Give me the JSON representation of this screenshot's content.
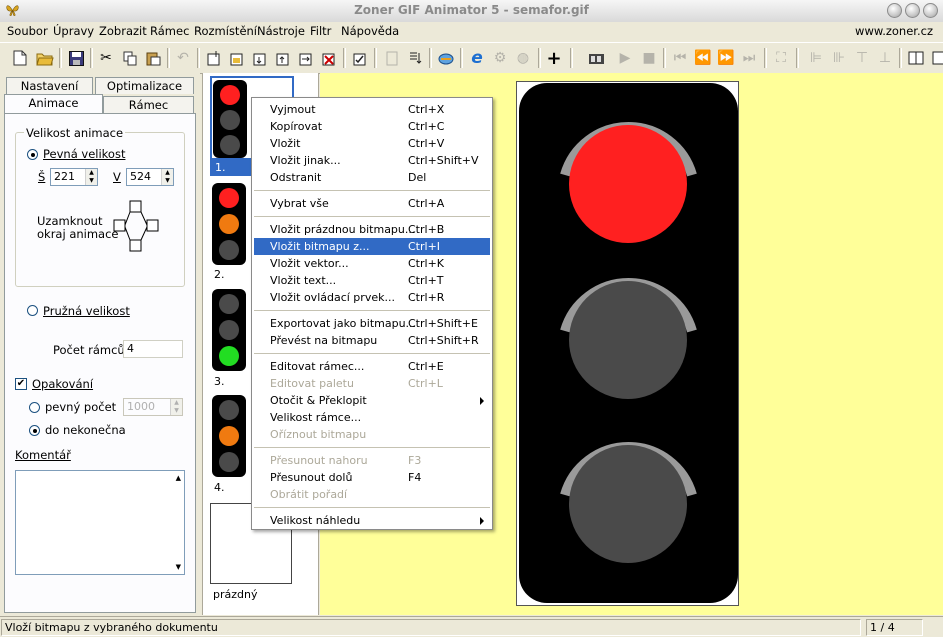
{
  "window": {
    "title": "Zoner GIF Animator 5 - semafor.gif"
  },
  "menubar": {
    "items": [
      "Soubor",
      "Úpravy",
      "Zobrazit",
      "Rámec",
      "Rozmístění",
      "Nástroje",
      "Filtr",
      "Nápověda"
    ],
    "url": "www.zoner.cz"
  },
  "toolbar": {
    "icons": [
      "new-icon",
      "open-icon",
      "save-icon",
      "cut-icon",
      "copy-icon",
      "paste-icon",
      "undo-icon",
      "frame-new-icon",
      "frame-open-icon",
      "frame-insert-icon",
      "frame-up-icon",
      "frame-down-icon",
      "frame-delete-icon",
      "frame-edit-icon",
      "optimize-icon",
      "sort-icon",
      "browser-preview-icon",
      "ie-icon",
      "gear-disabled-icon",
      "globe-disabled-icon",
      "plus-icon",
      "film-icon",
      "play-icon",
      "stop-icon",
      "first-icon",
      "prev-icon",
      "next-icon",
      "last-icon",
      "fit-icon",
      "align-icons",
      "layout-icon"
    ]
  },
  "left": {
    "tabs": {
      "nastaveni": "Nastavení",
      "optimalizace": "Optimalizace",
      "animace": "Animace",
      "ramec": "Rámec"
    },
    "velikost_label": "Velikost animace",
    "pevna": "Pevná velikost",
    "s_label": "Š",
    "s_value": "221",
    "v_label": "V",
    "v_value": "524",
    "lock_label_1": "Uzamknout",
    "lock_label_2": "okraj animace",
    "pruzna": "Pružná velikost",
    "pocet_label": "Počet rámců:",
    "pocet_value": "4",
    "opakovani": "Opakování",
    "pevny_pocet": "pevný počet",
    "pevny_value": "1000",
    "do_nekonecna": "do nekonečna",
    "komentar": "Komentář"
  },
  "thumbs": {
    "frames": [
      {
        "num": "1.",
        "lamps": [
          "#ff2020",
          "#4a4a4a",
          "#4a4a4a"
        ]
      },
      {
        "num": "2.",
        "lamps": [
          "#ff2020",
          "#f07a10",
          "#4a4a4a"
        ]
      },
      {
        "num": "3.",
        "lamps": [
          "#4a4a4a",
          "#4a4a4a",
          "#22dd22"
        ]
      },
      {
        "num": "4.",
        "lamps": [
          "#4a4a4a",
          "#f07a10",
          "#4a4a4a"
        ]
      }
    ],
    "empty_label": "prázdný"
  },
  "context_menu": {
    "items": [
      {
        "label": "Vyjmout",
        "key": "Ctrl+X",
        "state": "normal"
      },
      {
        "label": "Kopírovat",
        "key": "Ctrl+C",
        "state": "normal"
      },
      {
        "label": "Vložit",
        "key": "Ctrl+V",
        "state": "normal"
      },
      {
        "label": "Vložit jinak...",
        "key": "Ctrl+Shift+V",
        "state": "normal"
      },
      {
        "label": "Odstranit",
        "key": "Del",
        "state": "normal"
      },
      {
        "sep": true
      },
      {
        "label": "Vybrat vše",
        "key": "Ctrl+A",
        "state": "normal"
      },
      {
        "sep": true
      },
      {
        "label": "Vložit prázdnou bitmapu...",
        "key": "Ctrl+B",
        "state": "normal"
      },
      {
        "label": "Vložit bitmapu z...",
        "key": "Ctrl+I",
        "state": "highlighted"
      },
      {
        "label": "Vložit vektor...",
        "key": "Ctrl+K",
        "state": "normal"
      },
      {
        "label": "Vložit text...",
        "key": "Ctrl+T",
        "state": "normal"
      },
      {
        "label": "Vložit ovládací prvek...",
        "key": "Ctrl+R",
        "state": "normal"
      },
      {
        "sep": true
      },
      {
        "label": "Exportovat jako bitmapu...",
        "key": "Ctrl+Shift+E",
        "state": "normal"
      },
      {
        "label": "Převést na bitmapu",
        "key": "Ctrl+Shift+R",
        "state": "normal"
      },
      {
        "sep": true
      },
      {
        "label": "Editovat rámec...",
        "key": "Ctrl+E",
        "state": "normal"
      },
      {
        "label": "Editovat paletu",
        "key": "Ctrl+L",
        "state": "disabled"
      },
      {
        "label": "Otočit & Překlopit",
        "key": "",
        "state": "submenu"
      },
      {
        "label": "Velikost rámce...",
        "key": "",
        "state": "normal"
      },
      {
        "label": "Oříznout bitmapu",
        "key": "",
        "state": "disabled"
      },
      {
        "sep": true
      },
      {
        "label": "Přesunout nahoru",
        "key": "F3",
        "state": "disabled"
      },
      {
        "label": "Přesunout dolů",
        "key": "F4",
        "state": "normal"
      },
      {
        "label": "Obrátit pořadí",
        "key": "",
        "state": "disabled"
      },
      {
        "sep": true
      },
      {
        "label": "Velikost náhledu",
        "key": "",
        "state": "submenu"
      }
    ]
  },
  "canvas": {
    "background": "#ffff99",
    "lamps": [
      "#ff2020",
      "#4a4a4a",
      "#4a4a4a"
    ]
  },
  "status": {
    "text": "Vloží bitmapu z vybraného dokumentu",
    "page": "1 / 4"
  }
}
